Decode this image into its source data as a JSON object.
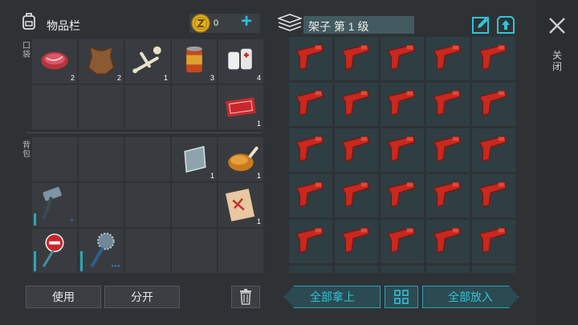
{
  "inventory": {
    "title": "物品栏",
    "coins": "0",
    "add_icon": "plus-icon",
    "pocket_label": "口袋",
    "bag_label": "背包",
    "pocket_slots": [
      {
        "item": "raw-meat-icon",
        "count": "2"
      },
      {
        "item": "leather-hide-icon",
        "count": "2"
      },
      {
        "item": "bones-icon",
        "count": "1"
      },
      {
        "item": "canned-food-icon",
        "count": "3"
      },
      {
        "item": "bandage-icon",
        "count": "4"
      },
      {
        "item": "",
        "count": ""
      },
      {
        "item": "",
        "count": ""
      },
      {
        "item": "",
        "count": ""
      },
      {
        "item": "",
        "count": ""
      },
      {
        "item": "coupon-icon",
        "count": "1"
      }
    ],
    "bag_slots": [
      {
        "item": "",
        "count": ""
      },
      {
        "item": "",
        "count": ""
      },
      {
        "item": "",
        "count": ""
      },
      {
        "item": "metal-plate-icon",
        "count": "1"
      },
      {
        "item": "roast-chicken-icon",
        "count": "1"
      },
      {
        "item": "sledgehammer-icon",
        "count": "",
        "durability": 0.3,
        "dots": "•"
      },
      {
        "item": "",
        "count": ""
      },
      {
        "item": "",
        "count": ""
      },
      {
        "item": "",
        "count": ""
      },
      {
        "item": "blueprint-icon",
        "count": "1"
      },
      {
        "item": "stop-sign-icon",
        "count": "",
        "durability": 0.5
      },
      {
        "item": "saw-club-icon",
        "count": "",
        "durability": 0.5,
        "dots": "•••"
      },
      {
        "item": "",
        "count": ""
      },
      {
        "item": "",
        "count": ""
      },
      {
        "item": "",
        "count": ""
      }
    ],
    "use_label": "使用",
    "split_label": "分开"
  },
  "storage": {
    "title": "架子 第 1 级",
    "item": "flare-gun-icon",
    "take_all_label": "全部拿上",
    "put_all_label": "全部放入"
  },
  "close": {
    "label": "关闭"
  },
  "colors": {
    "accent": "#2ec5d8",
    "flare_gun": "#c8281e",
    "coin": "#e0b020"
  }
}
